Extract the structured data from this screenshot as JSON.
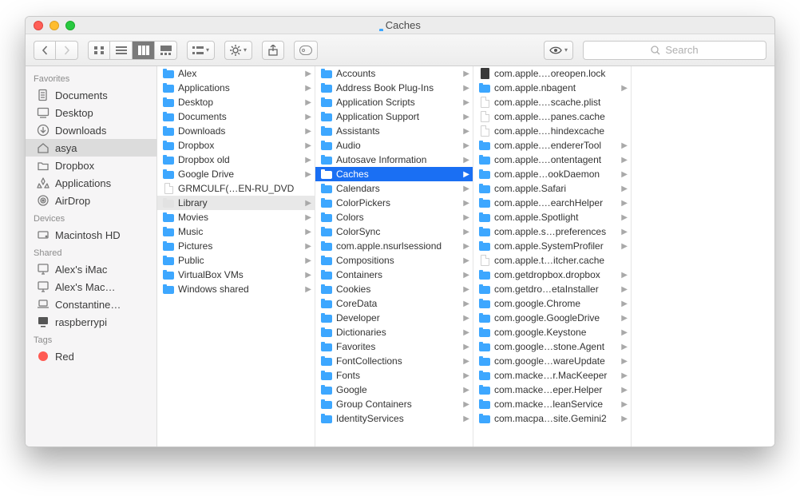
{
  "title": "Caches",
  "search_placeholder": "Search",
  "sidebar": {
    "sections": [
      {
        "heading": "Favorites",
        "items": [
          {
            "label": "Documents",
            "icon": "doc"
          },
          {
            "label": "Desktop",
            "icon": "desktop"
          },
          {
            "label": "Downloads",
            "icon": "download"
          },
          {
            "label": "asya",
            "icon": "home",
            "selected": true
          },
          {
            "label": "Dropbox",
            "icon": "folder-outline"
          },
          {
            "label": "Applications",
            "icon": "apps"
          },
          {
            "label": "AirDrop",
            "icon": "airdrop"
          }
        ]
      },
      {
        "heading": "Devices",
        "items": [
          {
            "label": "Macintosh HD",
            "icon": "hdd"
          }
        ]
      },
      {
        "heading": "Shared",
        "items": [
          {
            "label": "Alex's iMac",
            "icon": "imac"
          },
          {
            "label": "Alex's Mac…",
            "icon": "imac"
          },
          {
            "label": "Constantine…",
            "icon": "laptop"
          },
          {
            "label": "raspberrypi",
            "icon": "monitor"
          }
        ]
      },
      {
        "heading": "Tags",
        "items": [
          {
            "label": "Red",
            "icon": "tag-red"
          }
        ]
      }
    ]
  },
  "columns": [
    [
      {
        "label": "Alex",
        "type": "folder",
        "arrow": true
      },
      {
        "label": "Applications",
        "type": "folder",
        "arrow": true
      },
      {
        "label": "Desktop",
        "type": "folder",
        "arrow": true
      },
      {
        "label": "Documents",
        "type": "folder",
        "arrow": true
      },
      {
        "label": "Downloads",
        "type": "folder",
        "arrow": true
      },
      {
        "label": "Dropbox",
        "type": "folder",
        "arrow": true
      },
      {
        "label": "Dropbox old",
        "type": "folder",
        "arrow": true
      },
      {
        "label": "Google Drive",
        "type": "folder",
        "arrow": true
      },
      {
        "label": "GRMCULF(…EN-RU_DVD",
        "type": "file",
        "arrow": false
      },
      {
        "label": "Library",
        "type": "folder-dim",
        "arrow": true,
        "dimmed": true
      },
      {
        "label": "Movies",
        "type": "folder",
        "arrow": true
      },
      {
        "label": "Music",
        "type": "folder",
        "arrow": true
      },
      {
        "label": "Pictures",
        "type": "folder",
        "arrow": true
      },
      {
        "label": "Public",
        "type": "folder",
        "arrow": true
      },
      {
        "label": "VirtualBox VMs",
        "type": "folder",
        "arrow": true
      },
      {
        "label": "Windows shared",
        "type": "folder",
        "arrow": true
      }
    ],
    [
      {
        "label": "Accounts",
        "type": "folder",
        "arrow": true
      },
      {
        "label": "Address Book Plug-Ins",
        "type": "folder",
        "arrow": true
      },
      {
        "label": "Application Scripts",
        "type": "folder",
        "arrow": true
      },
      {
        "label": "Application Support",
        "type": "folder",
        "arrow": true
      },
      {
        "label": "Assistants",
        "type": "folder",
        "arrow": true
      },
      {
        "label": "Audio",
        "type": "folder",
        "arrow": true
      },
      {
        "label": "Autosave Information",
        "type": "folder",
        "arrow": true
      },
      {
        "label": "Caches",
        "type": "folder",
        "arrow": true,
        "selected": true
      },
      {
        "label": "Calendars",
        "type": "folder",
        "arrow": true
      },
      {
        "label": "ColorPickers",
        "type": "folder",
        "arrow": true
      },
      {
        "label": "Colors",
        "type": "folder",
        "arrow": true
      },
      {
        "label": "ColorSync",
        "type": "folder",
        "arrow": true
      },
      {
        "label": "com.apple.nsurlsessiond",
        "type": "folder",
        "arrow": true
      },
      {
        "label": "Compositions",
        "type": "folder",
        "arrow": true
      },
      {
        "label": "Containers",
        "type": "folder",
        "arrow": true
      },
      {
        "label": "Cookies",
        "type": "folder",
        "arrow": true
      },
      {
        "label": "CoreData",
        "type": "folder",
        "arrow": true
      },
      {
        "label": "Developer",
        "type": "folder",
        "arrow": true
      },
      {
        "label": "Dictionaries",
        "type": "folder",
        "arrow": true
      },
      {
        "label": "Favorites",
        "type": "folder",
        "arrow": true
      },
      {
        "label": "FontCollections",
        "type": "folder",
        "arrow": true
      },
      {
        "label": "Fonts",
        "type": "folder",
        "arrow": true
      },
      {
        "label": "Google",
        "type": "folder",
        "arrow": true
      },
      {
        "label": "Group Containers",
        "type": "folder",
        "arrow": true
      },
      {
        "label": "IdentityServices",
        "type": "folder",
        "arrow": true
      }
    ],
    [
      {
        "label": "com.apple.…oreopen.lock",
        "type": "blackfile",
        "arrow": false
      },
      {
        "label": "com.apple.nbagent",
        "type": "folder",
        "arrow": true
      },
      {
        "label": "com.apple.…scache.plist",
        "type": "file",
        "arrow": false
      },
      {
        "label": "com.apple.…panes.cache",
        "type": "file",
        "arrow": false
      },
      {
        "label": "com.apple.…hindexcache",
        "type": "file",
        "arrow": false
      },
      {
        "label": "com.apple.…endererTool",
        "type": "folder",
        "arrow": true
      },
      {
        "label": "com.apple.…ontentagent",
        "type": "folder",
        "arrow": true
      },
      {
        "label": "com.apple…ookDaemon",
        "type": "folder",
        "arrow": true
      },
      {
        "label": "com.apple.Safari",
        "type": "folder",
        "arrow": true
      },
      {
        "label": "com.apple.…earchHelper",
        "type": "folder",
        "arrow": true
      },
      {
        "label": "com.apple.Spotlight",
        "type": "folder",
        "arrow": true
      },
      {
        "label": "com.apple.s…preferences",
        "type": "folder",
        "arrow": true
      },
      {
        "label": "com.apple.SystemProfiler",
        "type": "folder",
        "arrow": true
      },
      {
        "label": "com.apple.t…itcher.cache",
        "type": "file",
        "arrow": false
      },
      {
        "label": "com.getdropbox.dropbox",
        "type": "folder",
        "arrow": true
      },
      {
        "label": "com.getdro…etaInstaller",
        "type": "folder",
        "arrow": true
      },
      {
        "label": "com.google.Chrome",
        "type": "folder",
        "arrow": true
      },
      {
        "label": "com.google.GoogleDrive",
        "type": "folder",
        "arrow": true
      },
      {
        "label": "com.google.Keystone",
        "type": "folder",
        "arrow": true
      },
      {
        "label": "com.google…stone.Agent",
        "type": "folder",
        "arrow": true
      },
      {
        "label": "com.google…wareUpdate",
        "type": "folder",
        "arrow": true
      },
      {
        "label": "com.macke…r.MacKeeper",
        "type": "folder",
        "arrow": true
      },
      {
        "label": "com.macke…eper.Helper",
        "type": "folder",
        "arrow": true
      },
      {
        "label": "com.macke…leanService",
        "type": "folder",
        "arrow": true
      },
      {
        "label": "com.macpa…site.Gemini2",
        "type": "folder",
        "arrow": true
      }
    ]
  ]
}
